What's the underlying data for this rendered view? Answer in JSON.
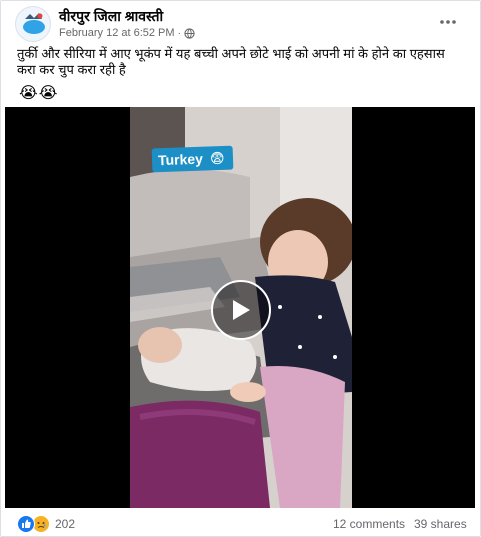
{
  "post": {
    "page_name": "वीरपुर जिला श्रावस्ती",
    "timestamp": "February 12 at 6:52 PM",
    "separator": "·",
    "privacy_icon": "globe-icon",
    "text": "तुर्की और सीरिया में आए भूकंप में यह बच्ची अपने छोटे भाई को अपनी मां के होने का एहसास करा कर चुप करा रही है",
    "emojis": [
      "😭",
      "😭"
    ]
  },
  "video": {
    "overlay_label": "Turkey",
    "overlay_emoji": "😨"
  },
  "footer": {
    "reaction_count": "202",
    "comments": "12 comments",
    "shares": "39 shares"
  },
  "colors": {
    "accent": "#1877f2",
    "secondary_text": "#65676b",
    "tag_blue": "#1d8fc7"
  }
}
